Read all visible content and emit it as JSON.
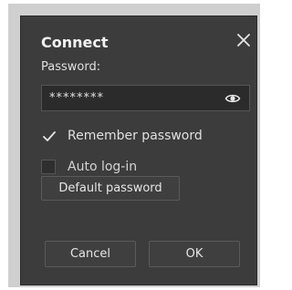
{
  "dialog": {
    "title": "Connect",
    "password_label": "Password:",
    "password_value": "********",
    "options": [
      {
        "label": "Remember password",
        "checked": true
      },
      {
        "label": "Auto log-in",
        "checked": false
      }
    ],
    "default_password_label": "Default password",
    "cancel_label": "Cancel",
    "ok_label": "OK"
  },
  "icons": {
    "close": "close-icon",
    "show_password": "eye-icon",
    "check": "checkmark-icon"
  }
}
